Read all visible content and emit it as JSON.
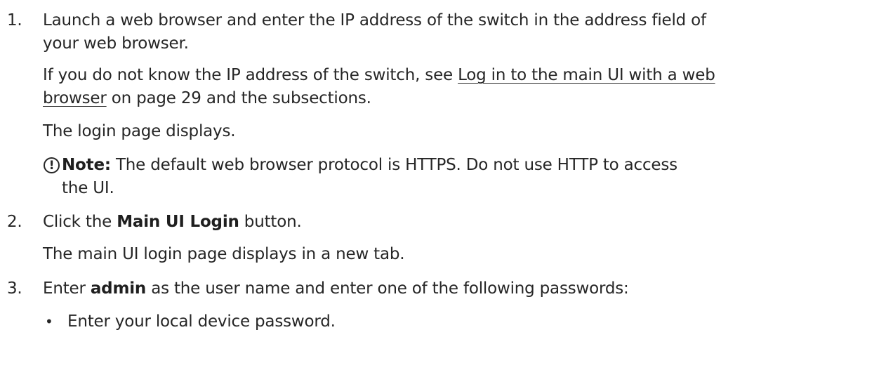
{
  "steps": [
    {
      "number": "1.",
      "line1": "Launch a web browser and enter the IP address of the switch in the address field of",
      "line2": "your web browser.",
      "para2_before": "If you do not know the IP address of the switch, see ",
      "para2_link1": "Log in to the main UI with a web",
      "para2_link2": "browser",
      "para2_after": " on page 29 and the subsections.",
      "para3": "The login page displays.",
      "note_icon": "!",
      "note_label": "Note:",
      "note_text1": " The default web browser protocol is HTTPS. Do not use HTTP to access",
      "note_text2": "the UI."
    },
    {
      "number": "2.",
      "text_before": "Click the ",
      "text_bold": "Main UI Login",
      "text_after": " button.",
      "para2": "The main UI login page displays in a new tab."
    },
    {
      "number": "3.",
      "text_before": "Enter ",
      "text_bold": "admin",
      "text_after": " as the user name and enter one of the following passwords:",
      "bullets": [
        "Enter your local device password."
      ]
    }
  ]
}
